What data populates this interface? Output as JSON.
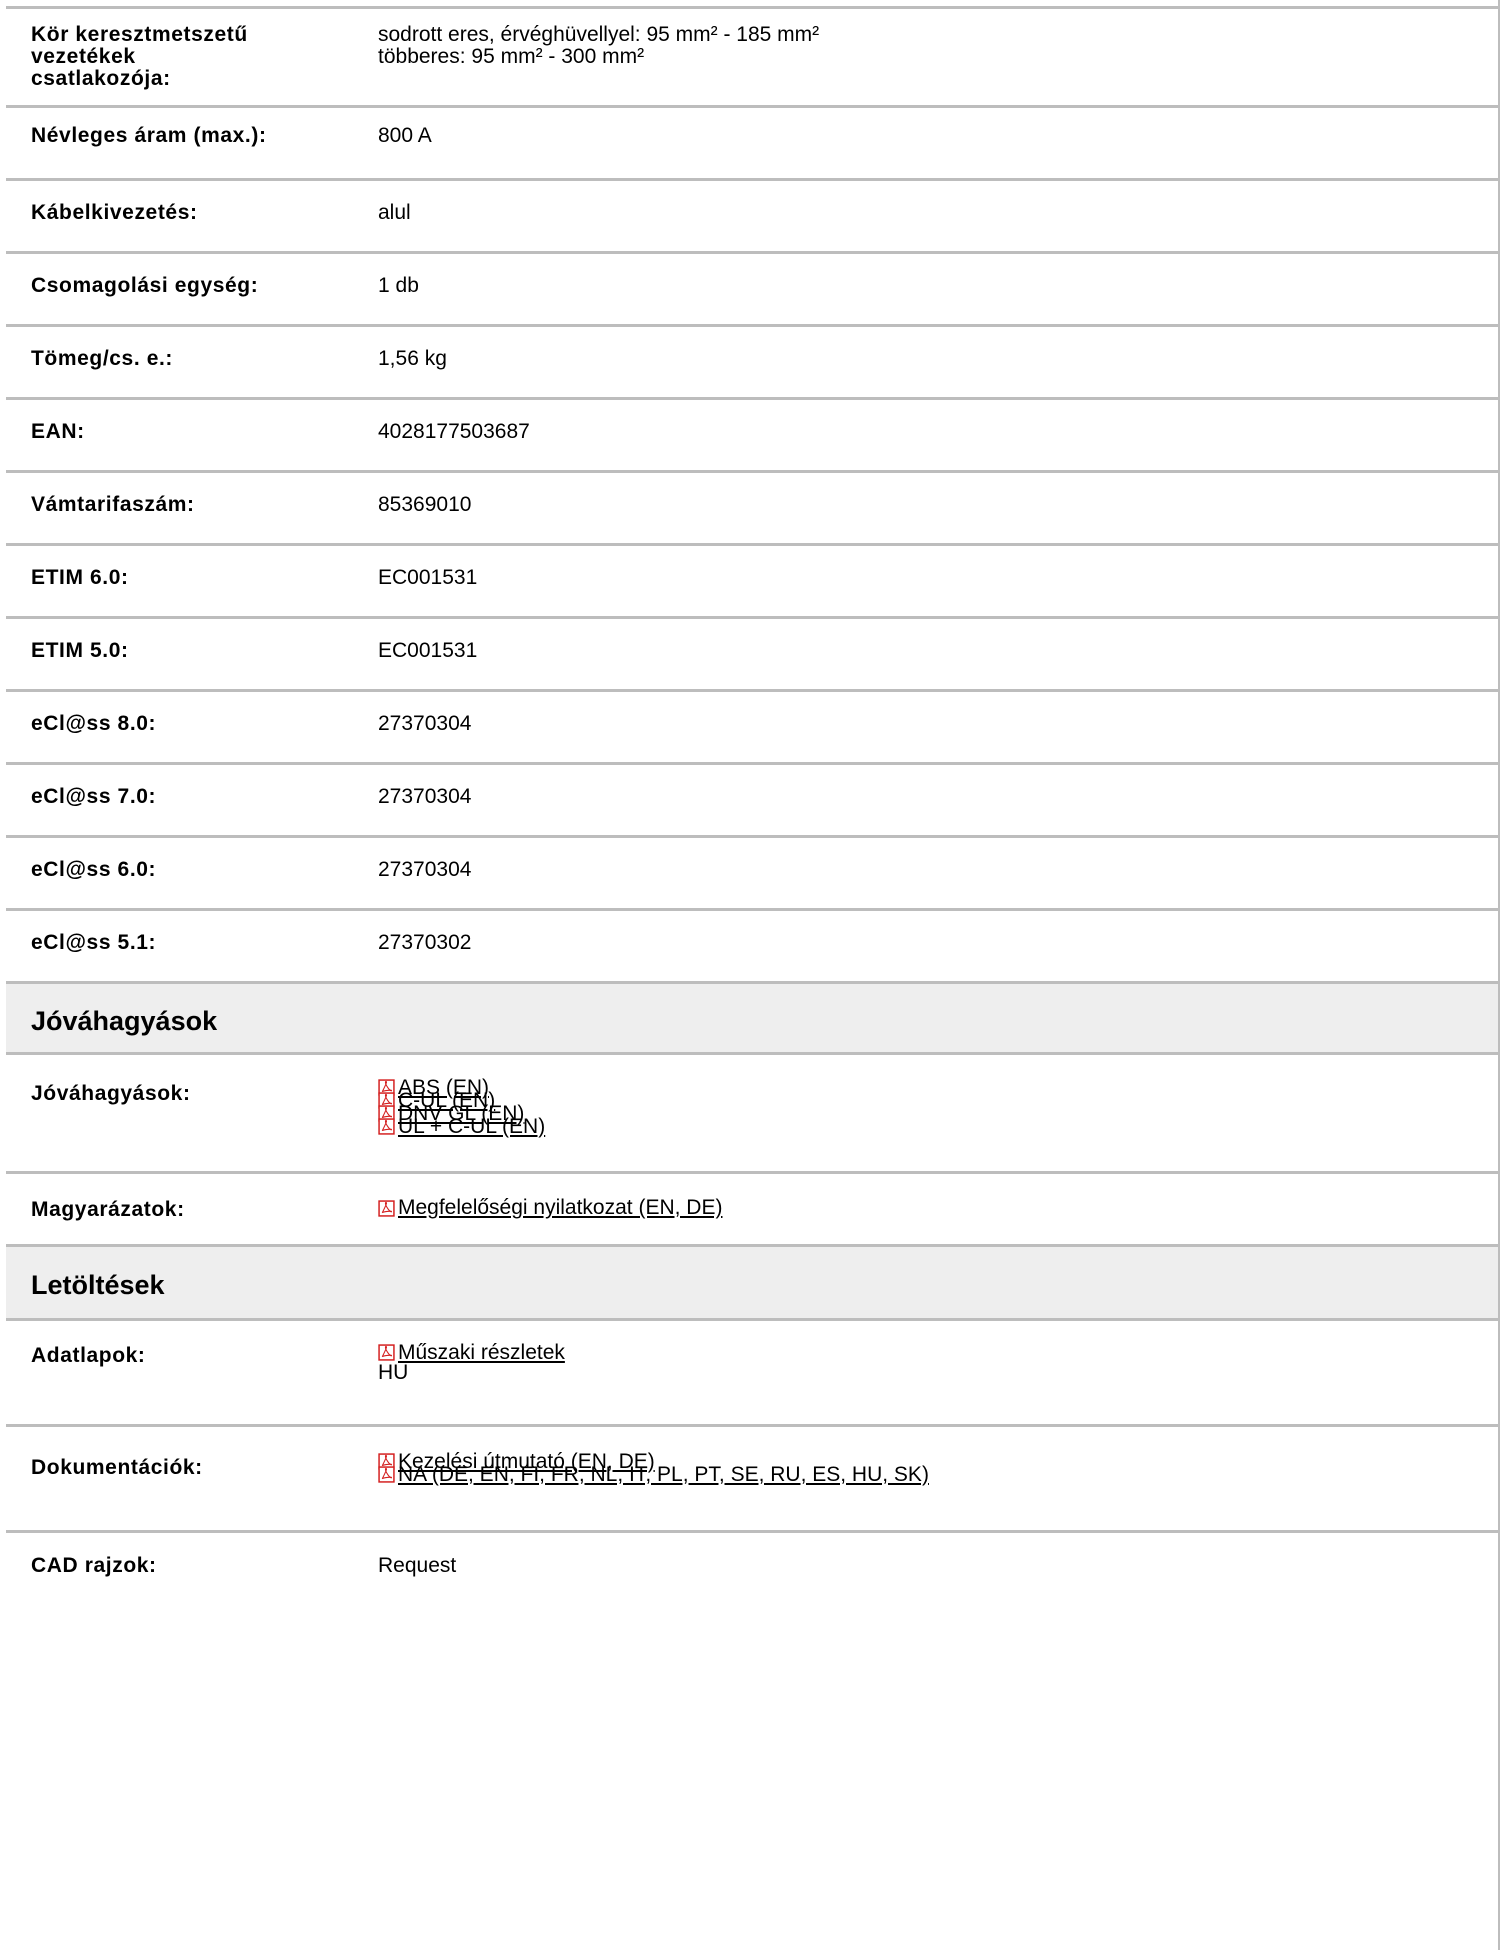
{
  "specs": [
    {
      "label": "Kör keresztmetszetű vezetékek csatlakozója:",
      "values": [
        "sodrott eres, érvéghüvellyel: 95 mm² - 185 mm²",
        "többeres: 95 mm² - 300 mm²"
      ]
    },
    {
      "label": "Névleges áram (max.):",
      "values": [
        "800 A"
      ]
    },
    {
      "label": "Kábelkivezetés:",
      "values": [
        "alul"
      ]
    },
    {
      "label": "Csomagolási egység:",
      "values": [
        "1 db"
      ]
    },
    {
      "label": "Tömeg/cs. e.:",
      "values": [
        "1,56 kg"
      ]
    },
    {
      "label": "EAN:",
      "values": [
        "4028177503687"
      ]
    },
    {
      "label": "Vámtarifaszám:",
      "values": [
        "85369010"
      ]
    },
    {
      "label": "ETIM 6.0:",
      "values": [
        "EC001531"
      ]
    },
    {
      "label": "ETIM 5.0:",
      "values": [
        "EC001531"
      ]
    },
    {
      "label": "eCl@ss 8.0:",
      "values": [
        "27370304"
      ]
    },
    {
      "label": "eCl@ss 7.0:",
      "values": [
        "27370304"
      ]
    },
    {
      "label": "eCl@ss 6.0:",
      "values": [
        "27370304"
      ]
    },
    {
      "label": "eCl@ss 5.1:",
      "values": [
        "27370302"
      ]
    }
  ],
  "approvals_section": {
    "title": "Jóváhagyások",
    "rows": [
      {
        "label": "Jóváhagyások:",
        "links": [
          "ABS (EN)",
          "C-UL (EN)",
          "DNV GL (EN)",
          "UL + C-UL (EN)"
        ]
      },
      {
        "label": "Magyarázatok:",
        "links": [
          "Megfelelőségi nyilatkozat (EN, DE)"
        ]
      }
    ]
  },
  "downloads_section": {
    "title": "Letöltések",
    "rows": [
      {
        "label": "Adatlapok:",
        "links": [
          "Műszaki részletek"
        ],
        "extra": "HU"
      },
      {
        "label": "Dokumentációk:",
        "links": [
          "Kezelési útmutató (EN, DE)",
          "NA (DE, EN, FI, FR, NL, IT, PL, PT, SE, RU, ES, HU, SK)"
        ]
      },
      {
        "label": "CAD rajzok:",
        "values": [
          "Request"
        ]
      }
    ]
  },
  "icons": {
    "document": "pdf-icon"
  },
  "colors": {
    "divider": "#bdbdbd",
    "section_bg": "#eeeeee",
    "pdf_red": "#d42020"
  }
}
